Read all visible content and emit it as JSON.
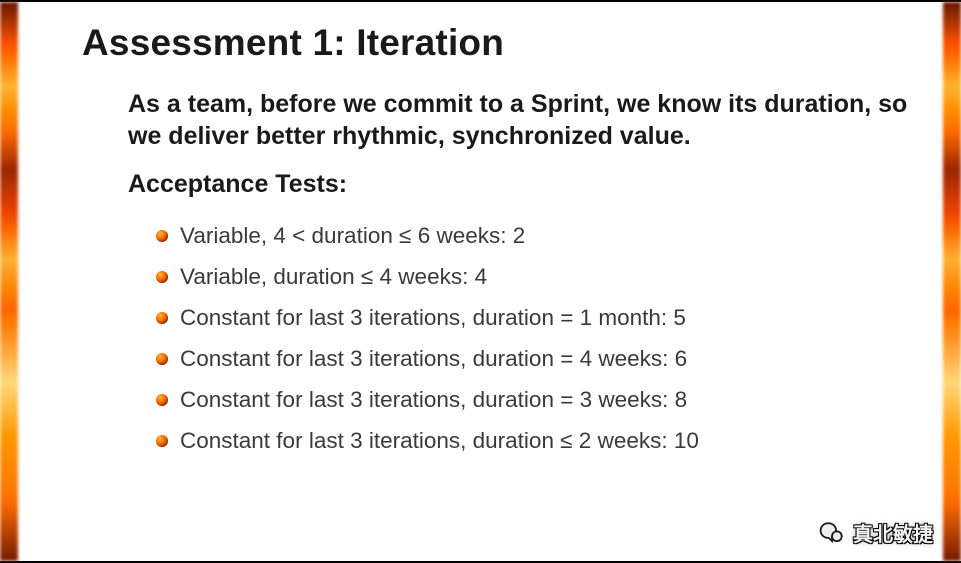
{
  "title": "Assessment 1: Iteration",
  "lead": "As a team, before we commit to a Sprint, we know its duration, so we deliver better rhythmic, synchronized value.",
  "section_label": "Acceptance Tests:",
  "items": [
    "Variable, 4 < duration ≤ 6 weeks:  2",
    "Variable, duration ≤ 4 weeks:  4",
    "Constant for last 3 iterations, duration = 1 month: 5",
    "Constant for last 3 iterations, duration = 4 weeks: 6",
    "Constant for last 3 iterations, duration = 3 weeks: 8",
    "Constant for last 3 iterations, duration ≤ 2 weeks: 10"
  ],
  "watermark": "真北敏捷"
}
